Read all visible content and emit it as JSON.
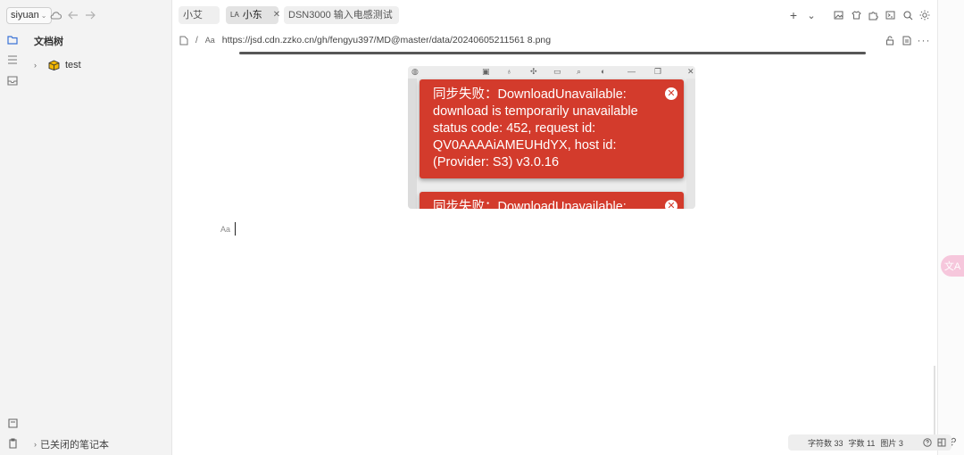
{
  "sidebar": {
    "workspace": "siyuan",
    "filetree_title": "文档树",
    "items": [
      {
        "label": "test",
        "icon": "notebook-icon"
      }
    ],
    "closed_notebooks": "已关闭的笔记本"
  },
  "tabs": [
    {
      "label": "小艾",
      "active": false
    },
    {
      "prefix": "LA",
      "label": "小东",
      "active": true
    },
    {
      "label": "DSN3000 输入电感测试",
      "active": false
    }
  ],
  "breadcrumb": {
    "separator": "/",
    "aa": "Aa",
    "url": "https://jsd.cdn.zzko.cn/gh/fengyu397/MD@master/data/20240605211561 8.png"
  },
  "screenshot": {
    "toasts": [
      {
        "text": "同步失败：DownloadUnavailable: download is temporarily unavailable status code: 452, request id: QV0AAAAiAMEUHdYX, host id: (Provider: S3) v3.0.16"
      },
      {
        "text": "同步失败：DownloadUnavailable:"
      }
    ]
  },
  "editor": {
    "block_marker": "Aa"
  },
  "statusbar": {
    "chars": "字符数 33",
    "words": "字数 11",
    "images": "图片 3"
  },
  "colors": {
    "toast_bg": "#d33b2c",
    "sidebar_bg": "#f3f3f3",
    "translate_btn": "#f6c7dc"
  }
}
